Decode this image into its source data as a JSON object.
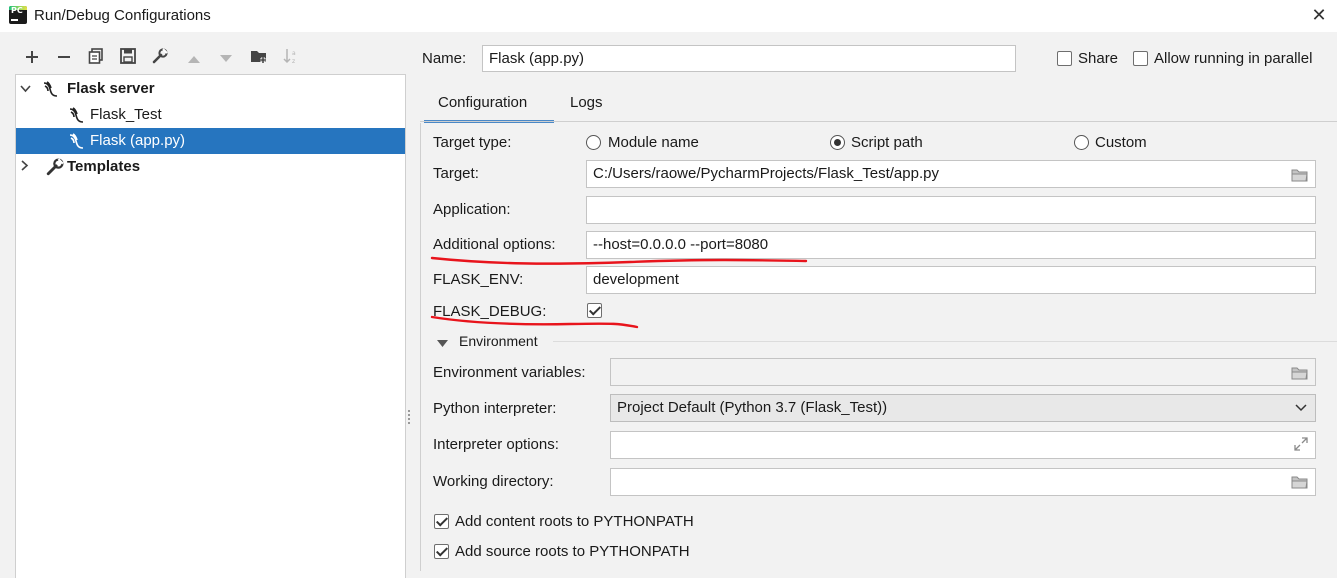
{
  "window": {
    "title": "Run/Debug Configurations",
    "close_glyph": "✕"
  },
  "toolbar": {
    "icons": [
      "add-icon",
      "remove-icon",
      "copy-icon",
      "save-icon",
      "wrench-icon",
      "move-up-icon",
      "move-down-icon",
      "new-folder-icon",
      "sort-icon"
    ]
  },
  "tree": {
    "items": [
      {
        "label": "Flask server",
        "icon": "flask-icon",
        "expanded": true
      },
      {
        "label": "Flask_Test",
        "icon": "flask-icon"
      },
      {
        "label": "Flask (app.py)",
        "icon": "flask-icon",
        "selected": true
      },
      {
        "label": "Templates",
        "icon": "wrench-icon",
        "expanded": false
      }
    ]
  },
  "header": {
    "name_label": "Name:",
    "name_value": "Flask (app.py)",
    "share_label": "Share",
    "share_checked": false,
    "parallel_label": "Allow running in parallel",
    "parallel_checked": false
  },
  "tabs": [
    {
      "label": "Configuration",
      "active": true
    },
    {
      "label": "Logs",
      "active": false
    }
  ],
  "form": {
    "target_type_label": "Target type:",
    "target_type_options": [
      "Module name",
      "Script path",
      "Custom"
    ],
    "target_type_selected": "Script path",
    "target_label": "Target:",
    "target_value": "C:/Users/raowe/PycharmProjects/Flask_Test/app.py",
    "application_label": "Application:",
    "application_value": "",
    "additional_label": "Additional options:",
    "additional_value": "--host=0.0.0.0 --port=8080",
    "flask_env_label": "FLASK_ENV:",
    "flask_env_value": "development",
    "flask_debug_label": "FLASK_DEBUG:",
    "flask_debug_checked": true,
    "environment_section": "Environment",
    "env_vars_label": "Environment variables:",
    "env_vars_value": "",
    "interpreter_label": "Python interpreter:",
    "interpreter_value": "Project Default (Python 3.7 (Flask_Test))",
    "interp_options_label": "Interpreter options:",
    "interp_options_value": "",
    "working_dir_label": "Working directory:",
    "working_dir_value": "",
    "content_roots_label": "Add content roots to PYTHONPATH",
    "content_roots_checked": true,
    "source_roots_label": "Add source roots to PYTHONPATH",
    "source_roots_checked": true
  },
  "colors": {
    "selection": "#2675bf",
    "tab_underline": "#4a88c7",
    "annotation": "#e8141c"
  }
}
